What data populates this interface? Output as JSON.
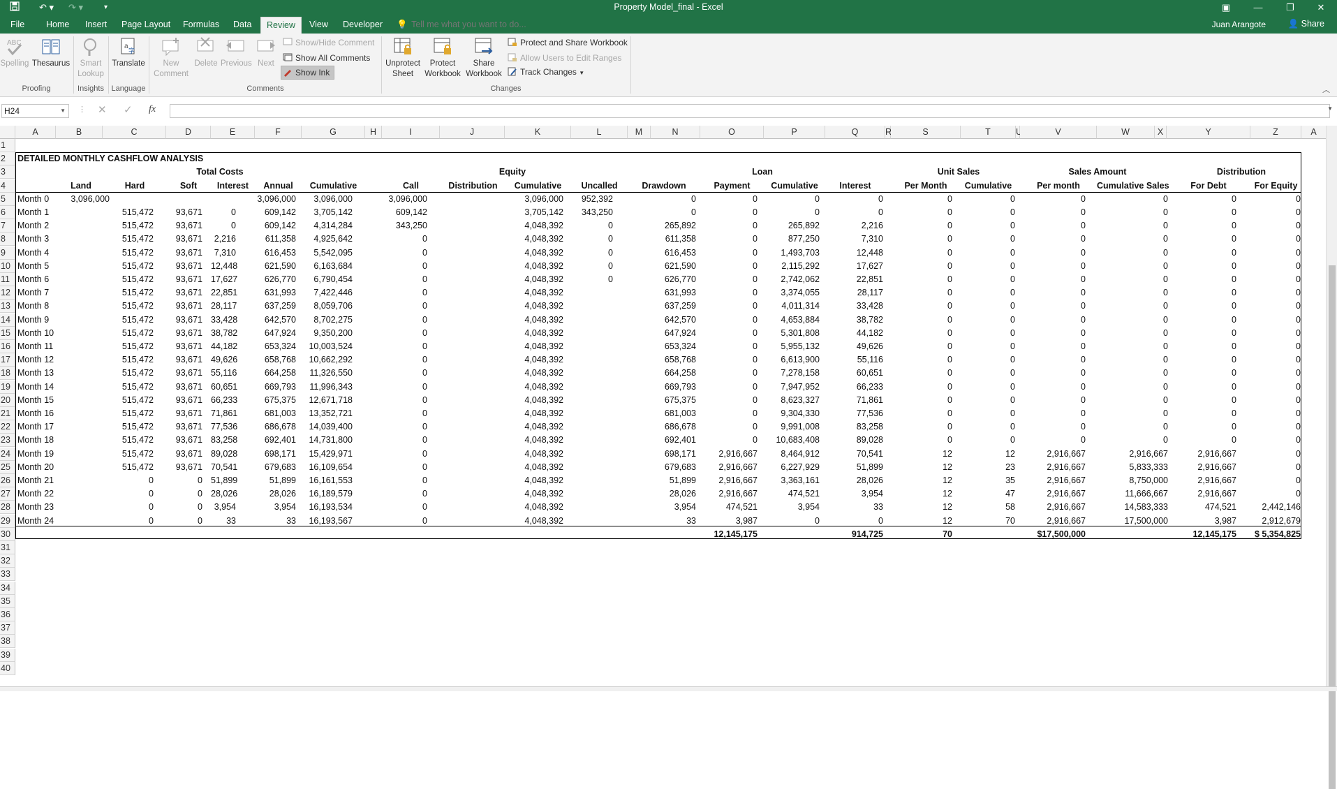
{
  "app": {
    "title": "Property Model_final - Excel",
    "user": "Juan Arangote",
    "share": "Share"
  },
  "menu": {
    "tabs": [
      "File",
      "Home",
      "Insert",
      "Page Layout",
      "Formulas",
      "Data",
      "Review",
      "View",
      "Developer"
    ],
    "active": "Review",
    "tell_me_placeholder": "Tell me what you want to do..."
  },
  "ribbon": {
    "proofing": {
      "spelling": "Spelling",
      "thesaurus": "Thesaurus",
      "label": "Proofing"
    },
    "insights": {
      "smart_lookup_1": "Smart",
      "smart_lookup_2": "Lookup",
      "label": "Insights"
    },
    "language": {
      "translate": "Translate",
      "label": "Language"
    },
    "comments": {
      "new_1": "New",
      "new_2": "Comment",
      "delete": "Delete",
      "previous": "Previous",
      "next": "Next",
      "show_hide": "Show/Hide Comment",
      "show_all": "Show All Comments",
      "show_ink": "Show Ink",
      "label": "Comments"
    },
    "changes": {
      "unprotect_1": "Unprotect",
      "unprotect_2": "Sheet",
      "protect_1": "Protect",
      "protect_2": "Workbook",
      "share_1": "Share",
      "share_2": "Workbook",
      "protect_share": "Protect and Share Workbook",
      "allow_edit": "Allow Users to Edit Ranges",
      "track": "Track Changes",
      "label": "Changes"
    }
  },
  "formula_bar": {
    "name_box": "H24",
    "formula": "",
    "fx": "fx"
  },
  "columns": [
    "A",
    "B",
    "C",
    "D",
    "E",
    "F",
    "G",
    "H",
    "I",
    "J",
    "K",
    "L",
    "M",
    "N",
    "O",
    "P",
    "Q",
    "R",
    "S",
    "T",
    "U",
    "V",
    "W",
    "X",
    "Y",
    "Z",
    "A"
  ],
  "rows_visible": 40,
  "sheet": {
    "title": "DETAILED MONTHLY CASHFLOW ANALYSIS",
    "group_headers": [
      "Total Costs",
      "Equity",
      "Loan",
      "Unit Sales",
      "Sales Amount",
      "Distribution"
    ],
    "col_headers": [
      "Land",
      "Hard",
      "Soft",
      "Interest",
      "Annual",
      "Cumulative",
      "Call",
      "Distribution",
      "Cumulative",
      "Uncalled",
      "Drawdown",
      "Payment",
      "Cumulative",
      "Interest",
      "Per Month",
      "Cumulative",
      "Per month",
      "Cumulative Sales",
      "For Debt",
      "For Equity"
    ],
    "data": [
      [
        "Month 0",
        "3,096,000",
        "",
        "",
        "",
        "3,096,000",
        "3,096,000",
        "3,096,000",
        "",
        "3,096,000",
        "952,392",
        "0",
        "0",
        "0",
        "0",
        "0",
        "0",
        "0",
        "0",
        "0",
        "0"
      ],
      [
        "Month 1",
        "",
        "515,472",
        "93,671",
        "0",
        "609,142",
        "3,705,142",
        "609,142",
        "",
        "3,705,142",
        "343,250",
        "0",
        "0",
        "0",
        "0",
        "0",
        "0",
        "0",
        "0",
        "0",
        "0"
      ],
      [
        "Month 2",
        "",
        "515,472",
        "93,671",
        "0",
        "609,142",
        "4,314,284",
        "343,250",
        "",
        "4,048,392",
        "0",
        "265,892",
        "0",
        "265,892",
        "2,216",
        "0",
        "0",
        "0",
        "0",
        "0",
        "0"
      ],
      [
        "Month 3",
        "",
        "515,472",
        "93,671",
        "2,216",
        "611,358",
        "4,925,642",
        "0",
        "",
        "4,048,392",
        "0",
        "611,358",
        "0",
        "877,250",
        "7,310",
        "0",
        "0",
        "0",
        "0",
        "0",
        "0"
      ],
      [
        "Month 4",
        "",
        "515,472",
        "93,671",
        "7,310",
        "616,453",
        "5,542,095",
        "0",
        "",
        "4,048,392",
        "0",
        "616,453",
        "0",
        "1,493,703",
        "12,448",
        "0",
        "0",
        "0",
        "0",
        "0",
        "0"
      ],
      [
        "Month 5",
        "",
        "515,472",
        "93,671",
        "12,448",
        "621,590",
        "6,163,684",
        "0",
        "",
        "4,048,392",
        "0",
        "621,590",
        "0",
        "2,115,292",
        "17,627",
        "0",
        "0",
        "0",
        "0",
        "0",
        "0"
      ],
      [
        "Month 6",
        "",
        "515,472",
        "93,671",
        "17,627",
        "626,770",
        "6,790,454",
        "0",
        "",
        "4,048,392",
        "0",
        "626,770",
        "0",
        "2,742,062",
        "22,851",
        "0",
        "0",
        "0",
        "0",
        "0",
        "0"
      ],
      [
        "Month 7",
        "",
        "515,472",
        "93,671",
        "22,851",
        "631,993",
        "7,422,446",
        "0",
        "",
        "4,048,392",
        "",
        "631,993",
        "0",
        "3,374,055",
        "28,117",
        "0",
        "0",
        "0",
        "0",
        "0",
        "0"
      ],
      [
        "Month 8",
        "",
        "515,472",
        "93,671",
        "28,117",
        "637,259",
        "8,059,706",
        "0",
        "",
        "4,048,392",
        "",
        "637,259",
        "0",
        "4,011,314",
        "33,428",
        "0",
        "0",
        "0",
        "0",
        "0",
        "0"
      ],
      [
        "Month 9",
        "",
        "515,472",
        "93,671",
        "33,428",
        "642,570",
        "8,702,275",
        "0",
        "",
        "4,048,392",
        "",
        "642,570",
        "0",
        "4,653,884",
        "38,782",
        "0",
        "0",
        "0",
        "0",
        "0",
        "0"
      ],
      [
        "Month 10",
        "",
        "515,472",
        "93,671",
        "38,782",
        "647,924",
        "9,350,200",
        "0",
        "",
        "4,048,392",
        "",
        "647,924",
        "0",
        "5,301,808",
        "44,182",
        "0",
        "0",
        "0",
        "0",
        "0",
        "0"
      ],
      [
        "Month 11",
        "",
        "515,472",
        "93,671",
        "44,182",
        "653,324",
        "10,003,524",
        "0",
        "",
        "4,048,392",
        "",
        "653,324",
        "0",
        "5,955,132",
        "49,626",
        "0",
        "0",
        "0",
        "0",
        "0",
        "0"
      ],
      [
        "Month 12",
        "",
        "515,472",
        "93,671",
        "49,626",
        "658,768",
        "10,662,292",
        "0",
        "",
        "4,048,392",
        "",
        "658,768",
        "0",
        "6,613,900",
        "55,116",
        "0",
        "0",
        "0",
        "0",
        "0",
        "0"
      ],
      [
        "Month 13",
        "",
        "515,472",
        "93,671",
        "55,116",
        "664,258",
        "11,326,550",
        "0",
        "",
        "4,048,392",
        "",
        "664,258",
        "0",
        "7,278,158",
        "60,651",
        "0",
        "0",
        "0",
        "0",
        "0",
        "0"
      ],
      [
        "Month 14",
        "",
        "515,472",
        "93,671",
        "60,651",
        "669,793",
        "11,996,343",
        "0",
        "",
        "4,048,392",
        "",
        "669,793",
        "0",
        "7,947,952",
        "66,233",
        "0",
        "0",
        "0",
        "0",
        "0",
        "0"
      ],
      [
        "Month 15",
        "",
        "515,472",
        "93,671",
        "66,233",
        "675,375",
        "12,671,718",
        "0",
        "",
        "4,048,392",
        "",
        "675,375",
        "0",
        "8,623,327",
        "71,861",
        "0",
        "0",
        "0",
        "0",
        "0",
        "0"
      ],
      [
        "Month 16",
        "",
        "515,472",
        "93,671",
        "71,861",
        "681,003",
        "13,352,721",
        "0",
        "",
        "4,048,392",
        "",
        "681,003",
        "0",
        "9,304,330",
        "77,536",
        "0",
        "0",
        "0",
        "0",
        "0",
        "0"
      ],
      [
        "Month 17",
        "",
        "515,472",
        "93,671",
        "77,536",
        "686,678",
        "14,039,400",
        "0",
        "",
        "4,048,392",
        "",
        "686,678",
        "0",
        "9,991,008",
        "83,258",
        "0",
        "0",
        "0",
        "0",
        "0",
        "0"
      ],
      [
        "Month 18",
        "",
        "515,472",
        "93,671",
        "83,258",
        "692,401",
        "14,731,800",
        "0",
        "",
        "4,048,392",
        "",
        "692,401",
        "0",
        "10,683,408",
        "89,028",
        "0",
        "0",
        "0",
        "0",
        "0",
        "0"
      ],
      [
        "Month 19",
        "",
        "515,472",
        "93,671",
        "89,028",
        "698,171",
        "15,429,971",
        "0",
        "",
        "4,048,392",
        "",
        "698,171",
        "2,916,667",
        "8,464,912",
        "70,541",
        "12",
        "12",
        "2,916,667",
        "2,916,667",
        "2,916,667",
        "0"
      ],
      [
        "Month 20",
        "",
        "515,472",
        "93,671",
        "70,541",
        "679,683",
        "16,109,654",
        "0",
        "",
        "4,048,392",
        "",
        "679,683",
        "2,916,667",
        "6,227,929",
        "51,899",
        "12",
        "23",
        "2,916,667",
        "5,833,333",
        "2,916,667",
        "0"
      ],
      [
        "Month 21",
        "",
        "0",
        "0",
        "51,899",
        "51,899",
        "16,161,553",
        "0",
        "",
        "4,048,392",
        "",
        "51,899",
        "2,916,667",
        "3,363,161",
        "28,026",
        "12",
        "35",
        "2,916,667",
        "8,750,000",
        "2,916,667",
        "0"
      ],
      [
        "Month 22",
        "",
        "0",
        "0",
        "28,026",
        "28,026",
        "16,189,579",
        "0",
        "",
        "4,048,392",
        "",
        "28,026",
        "2,916,667",
        "474,521",
        "3,954",
        "12",
        "47",
        "2,916,667",
        "11,666,667",
        "2,916,667",
        "0"
      ],
      [
        "Month 23",
        "",
        "0",
        "0",
        "3,954",
        "3,954",
        "16,193,534",
        "0",
        "",
        "4,048,392",
        "",
        "3,954",
        "474,521",
        "3,954",
        "33",
        "12",
        "58",
        "2,916,667",
        "14,583,333",
        "474,521",
        "2,442,146"
      ],
      [
        "Month 24",
        "",
        "0",
        "0",
        "33",
        "33",
        "16,193,567",
        "0",
        "",
        "4,048,392",
        "",
        "33",
        "3,987",
        "0",
        "0",
        "12",
        "70",
        "2,916,667",
        "17,500,000",
        "3,987",
        "2,912,679"
      ]
    ],
    "totals": {
      "payment": "12,145,175",
      "interest": "914,725",
      "units": "70",
      "sales": "$17,500,000",
      "for_debt": "12,145,175",
      "for_equity": "$   5,354,825"
    }
  }
}
